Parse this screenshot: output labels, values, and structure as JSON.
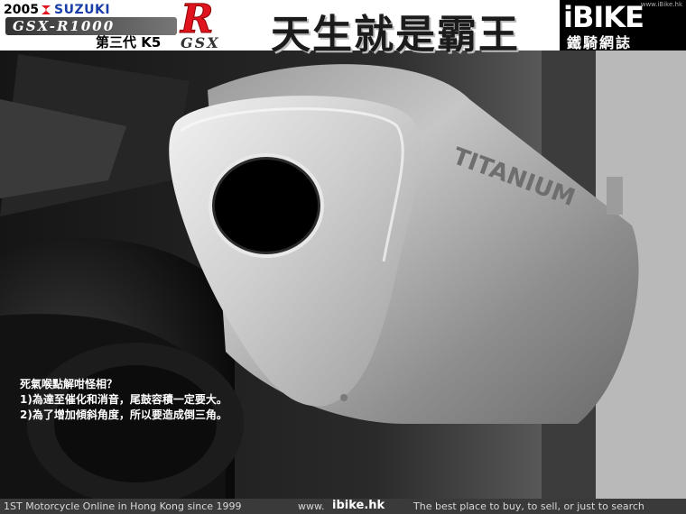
{
  "header": {
    "year": "2005",
    "brand": "SUZUKI",
    "model": "GSX-R1000",
    "generation": "第三代 K5",
    "logo_r": "R",
    "logo_gsx": "GSX",
    "slogan": "天生就是霸王"
  },
  "branding": {
    "url_small": "www.iBike.hk",
    "logo_word": "iBIKE",
    "logo_sub": "鐵騎網誌"
  },
  "photo": {
    "muffler_label": "TITANIUM"
  },
  "caption": {
    "line1": "死氣喉點解咁怪相？",
    "line2": "1)為達至催化和消音，尾鼓容積一定要大。",
    "line3": "2)為了增加傾斜角度，所以要造成倒三角。"
  },
  "footer": {
    "tagline_left": "1ST Motorcycle Online in Hong Kong since 1999",
    "site_prefix": "www.",
    "site_name": "ibike.hk",
    "tagline_right": "The best place to buy, to sell, or just to search"
  },
  "colors": {
    "suzuki_red": "#e0141e",
    "suzuki_blue": "#1a3fa8",
    "footer_bg": "#3a3a3a"
  }
}
